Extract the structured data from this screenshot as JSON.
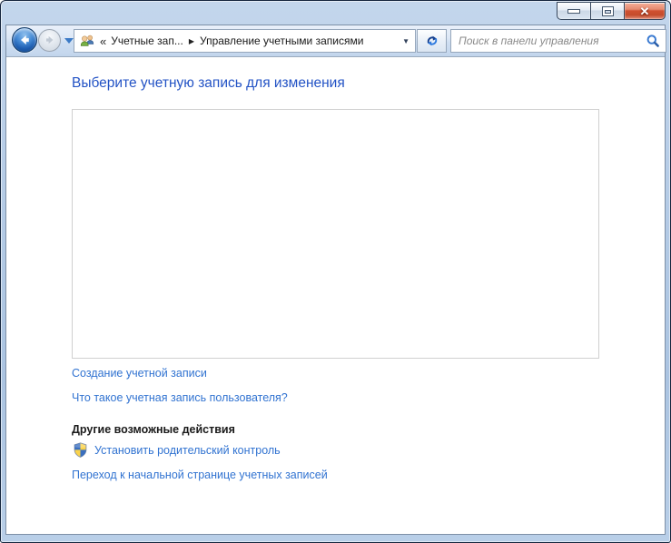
{
  "window": {
    "title": ""
  },
  "icons": {
    "close_glyph": "✕",
    "breadcrumb_overflow": "«",
    "breadcrumb_separator": "▶",
    "breadcrumb_dropdown": "▼"
  },
  "navbar": {
    "breadcrumb": {
      "items": [
        {
          "label": "Учетные зап..."
        },
        {
          "label": "Управление учетными записями"
        }
      ]
    },
    "search": {
      "placeholder": "Поиск в панели управления"
    }
  },
  "main": {
    "heading": "Выберите учетную запись для изменения",
    "create_account_link": "Создание учетной записи",
    "what_is_link": "Что такое учетная запись пользователя?",
    "other_actions_heading": "Другие возможные действия",
    "parental_control_link": "Установить родительский контроль",
    "home_link": "Переход к начальной странице учетных записей"
  },
  "colors": {
    "heading_blue": "#2353c5",
    "link_blue": "#3173d1",
    "close_button_red": "#cf5030",
    "frame_blue": "#b7cde7"
  }
}
